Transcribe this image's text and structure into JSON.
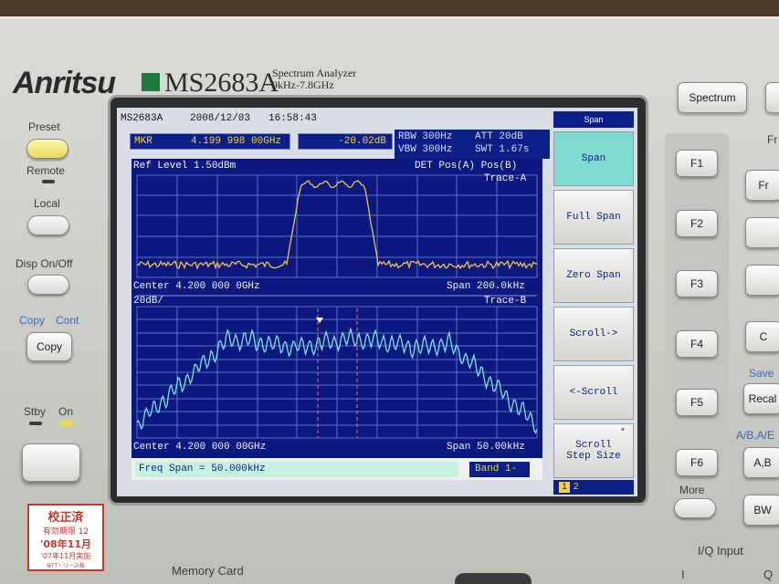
{
  "front_panel": {
    "brand": "Anritsu",
    "model": "MS2683A",
    "desc_line1": "Spectrum Analyzer",
    "desc_line2": "9kHz-7.8GHz",
    "left": {
      "preset": "Preset",
      "remote": "Remote",
      "local": "Local",
      "disp": "Disp On/Off",
      "copy_caption": "Copy",
      "cont_caption": "Cont",
      "copy": "Copy",
      "stby": "Stby",
      "on": "On"
    },
    "sticker": {
      "l1": "校正済",
      "l2": "有効期限 12",
      "l3": "'08年11月",
      "l4": "'07年11月実施",
      "l5": "NTT・リース株"
    },
    "right": {
      "spectrum": "Spectrum",
      "f_keys": [
        "F1",
        "F2",
        "F3",
        "F4",
        "F5",
        "F6"
      ],
      "more": "More",
      "fr": "Fr",
      "save": "Save",
      "recall": "Recal",
      "ab_caption": "A/B,A/E",
      "ab": "A,B",
      "bw": "BW",
      "iq_input": "I/Q  Input",
      "i": "I",
      "q": "Q",
      "c_partial": "C"
    },
    "memory_card": "Memory Card"
  },
  "screen": {
    "model": "MS2683A",
    "date": "2008/12/03",
    "time": "16:58:43",
    "marker": {
      "label": "MKR",
      "freq": "4.199 998 00GHz",
      "level": "-20.02dB"
    },
    "rbw": "RBW 300Hz",
    "vbw": "VBW 300Hz",
    "att": "ATT 20dB",
    "swt": "SWT 1.67s",
    "trace_a": {
      "ref_level": "Ref Level  1.50dBm",
      "det": "DET  Pos(A) Pos(B)",
      "name": "Trace-A",
      "center": "Center 4.200 000 0GHz",
      "span": "Span 200.0kHz"
    },
    "trace_b": {
      "scale": "20dB/",
      "name": "Trace-B",
      "center": "Center 4.200 000 00GHz",
      "span": "Span 50.00kHz"
    },
    "freq_input": "Freq Span = 50.000kHz",
    "band": "Band 1-",
    "softkey_title": "Span",
    "softkeys": [
      "Span",
      "Full Span",
      "Zero Span",
      "Scroll->",
      "<-Scroll",
      "Scroll\nStep Size"
    ],
    "softkey_star": "*",
    "page1": "1",
    "page2": "2",
    "colors": {
      "trace_a": "#f5c24a",
      "trace_b": "#7ee3e9",
      "plot_bg": "#0a1880",
      "marker_line": "#ff6a6a"
    }
  }
}
